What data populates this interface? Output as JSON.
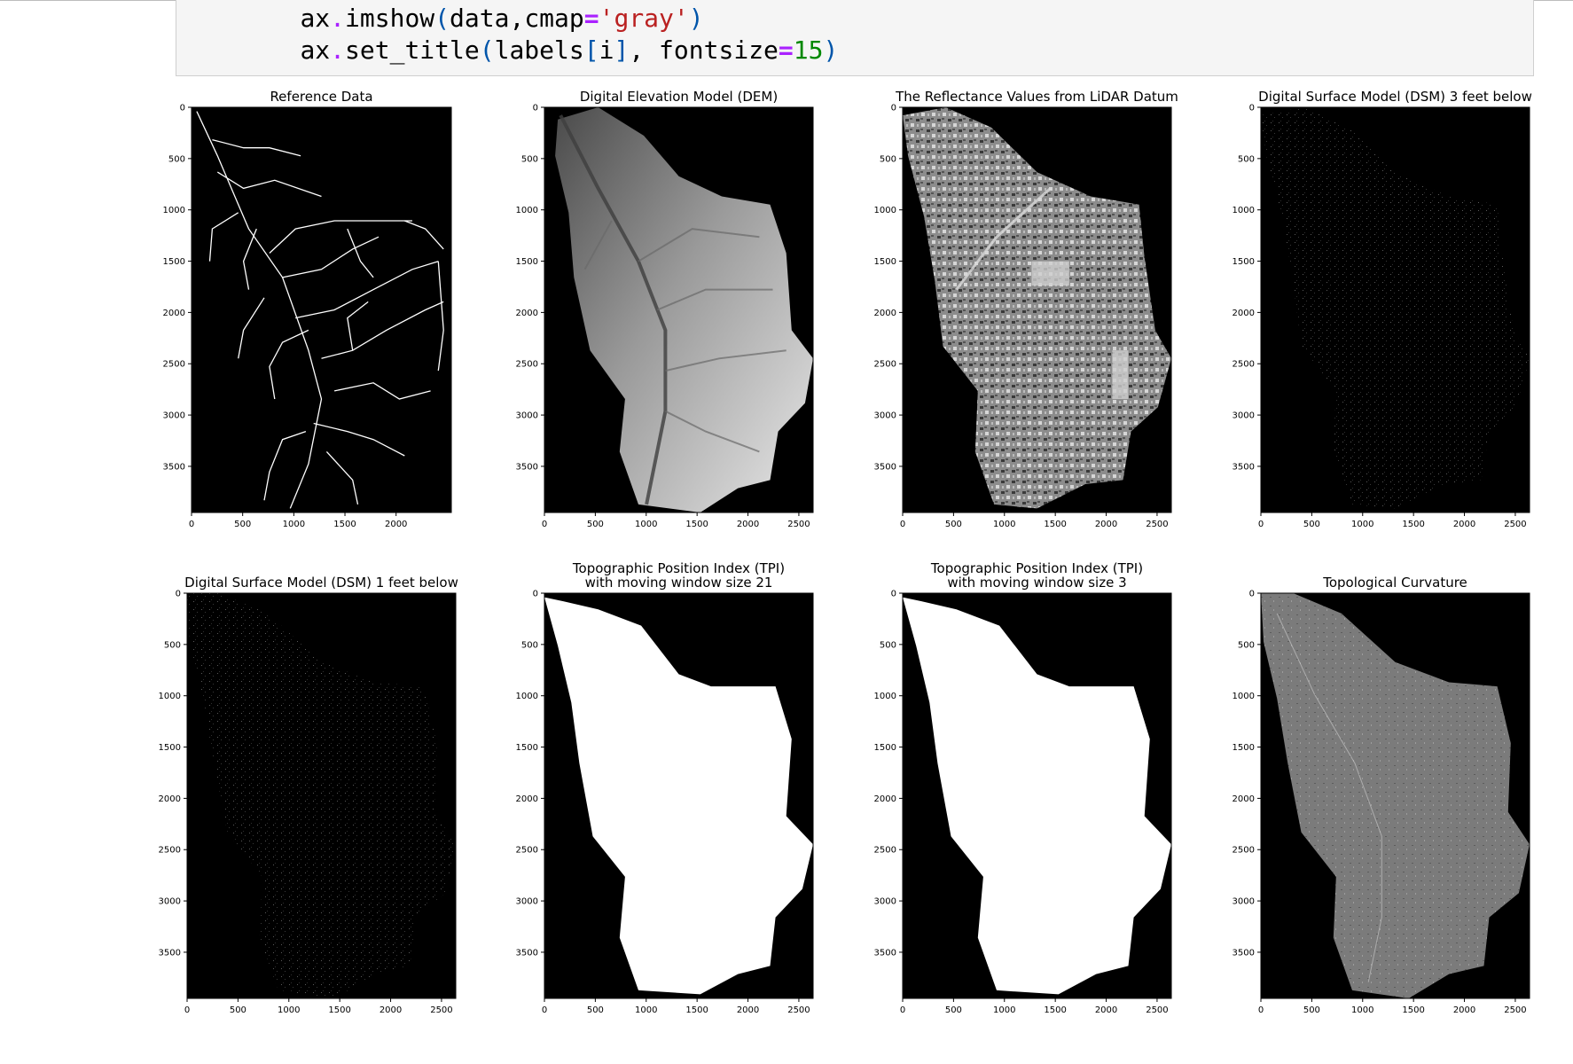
{
  "code": {
    "line1": {
      "indent": "    ",
      "obj": "ax",
      "dot": ".",
      "method": "imshow",
      "open": "(",
      "arg": "data,cmap",
      "eq": "=",
      "str": "'gray'",
      "close": ")"
    },
    "line2": {
      "indent": "    ",
      "obj": "ax",
      "dot": ".",
      "method": "set_title",
      "open": "(",
      "arg1": "labels",
      "lb": "[",
      "idx": "i",
      "rb": "]",
      "comma": ", ",
      "kw": "fontsize",
      "eq": "=",
      "num": "15",
      "close": ")"
    }
  },
  "colors": {
    "code_bg": "#f5f5f5",
    "panel_bg": "#000000",
    "axis": "#000000"
  },
  "panels": [
    {
      "title": [
        "Reference Data"
      ],
      "image_kind": "streams"
    },
    {
      "title": [
        "Digital Elevation Model (DEM)"
      ],
      "image_kind": "dem"
    },
    {
      "title": [
        "The Reflectance Values from LiDAR Datum"
      ],
      "image_kind": "reflectance"
    },
    {
      "title": [
        "Digital Surface Model (DSM) 3 feet below"
      ],
      "image_kind": "sparse"
    },
    {
      "title": [
        "Digital Surface Model (DSM) 1 feet below"
      ],
      "image_kind": "sparse"
    },
    {
      "title": [
        "Topographic Position Index (TPI)",
        "with moving window size 21"
      ],
      "image_kind": "mask"
    },
    {
      "title": [
        "Topographic Position Index (TPI)",
        "with moving window size 3"
      ],
      "image_kind": "mask"
    },
    {
      "title": [
        "Topological Curvature"
      ],
      "image_kind": "curvature"
    }
  ],
  "axes": {
    "y_ticks": [
      "0",
      "500",
      "1000",
      "1500",
      "2000",
      "2500",
      "3000",
      "3500"
    ],
    "x_ticks_default": [
      "0",
      "500",
      "1000",
      "1500",
      "2000",
      "2500"
    ],
    "x_ticks_reference": [
      "0",
      "500",
      "1000",
      "1500",
      "2000"
    ]
  }
}
